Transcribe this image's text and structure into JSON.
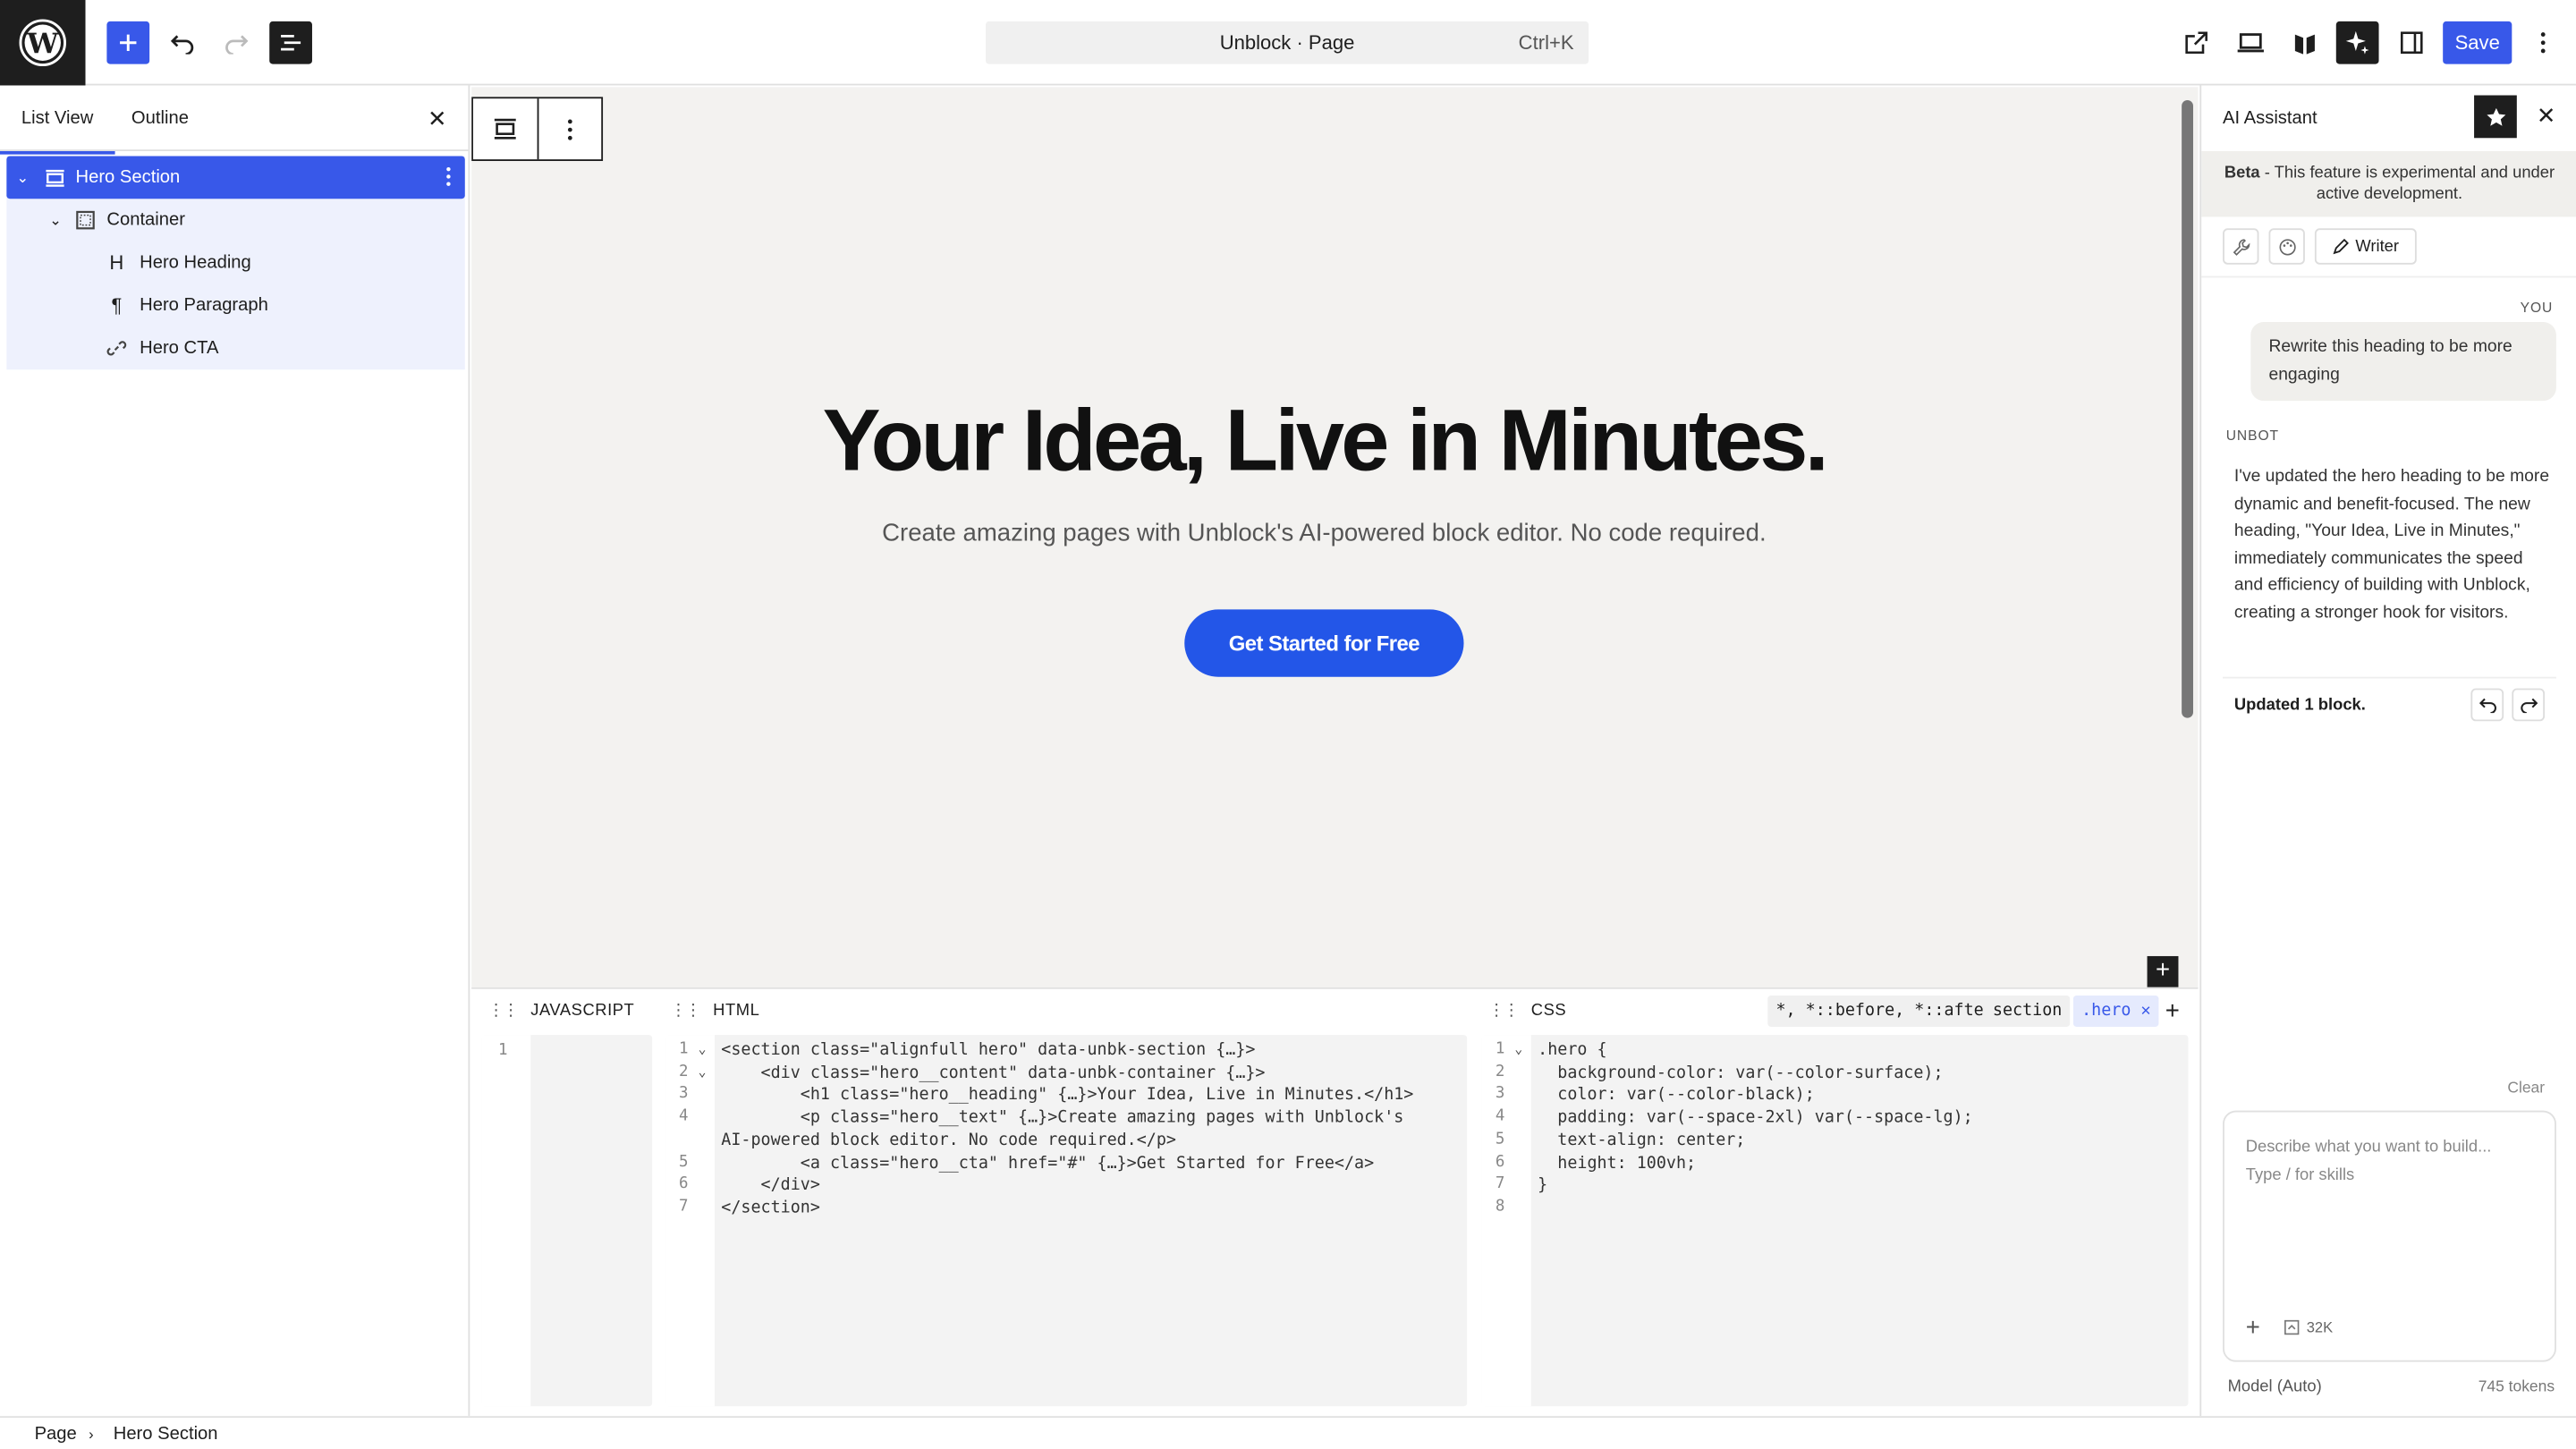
{
  "topbar": {
    "doc_title": "Unblock · Page",
    "shortcut": "Ctrl+K",
    "save_label": "Save"
  },
  "left_sidebar": {
    "tabs": [
      "List View",
      "Outline"
    ],
    "tree": [
      {
        "label": "Hero Section",
        "icon": "section-icon",
        "selected": true
      },
      {
        "label": "Container",
        "icon": "container-icon"
      },
      {
        "label": "Hero Heading",
        "icon": "heading-icon"
      },
      {
        "label": "Hero Paragraph",
        "icon": "paragraph-icon"
      },
      {
        "label": "Hero CTA",
        "icon": "link-icon"
      }
    ]
  },
  "canvas": {
    "heading": "Your Idea, Live in Minutes.",
    "paragraph": "Create amazing pages with Unblock's AI-powered block editor. No code required.",
    "cta": "Get Started for Free"
  },
  "code_panels": {
    "js_title": "JAVASCRIPT",
    "html_title": "HTML",
    "css_title": "CSS",
    "css_selectors": [
      "*, *::before, *::after",
      "section",
      ".hero"
    ],
    "html_lines": [
      "<section class=\"alignfull hero\" data-unbk-section {…}>",
      "    <div class=\"hero__content\" data-unbk-container {…}>",
      "        <h1 class=\"hero__heading\" {…}>Your Idea, Live in Minutes.</h1>",
      "        <p class=\"hero__text\" {…}>Create amazing pages with Unblock's",
      "AI-powered block editor. No code required.</p>",
      "        <a class=\"hero__cta\" href=\"#\" {…}>Get Started for Free</a>",
      "    </div>",
      "</section>"
    ],
    "css_lines": [
      ".hero {",
      "  background-color: var(--color-surface);",
      "  color: var(--color-black);",
      "  padding: var(--space-2xl) var(--space-lg);",
      "  text-align: center;",
      "  height: 100vh;",
      "}",
      ""
    ]
  },
  "assistant": {
    "title": "AI Assistant",
    "beta_strong": "Beta",
    "beta_text": " - This feature is experimental and under active development.",
    "writer_label": "Writer",
    "you_label": "YOU",
    "you_message": "Rewrite this heading to be more engaging",
    "bot_label": "UNBOT",
    "bot_message": "I've updated the hero heading to be more dynamic and benefit-focused. The new heading, \"Your Idea, Live in Minutes,\" immediately communicates the speed and efficiency of building with Unblock, creating a stronger hook for visitors.",
    "updated_text": "Updated 1 block.",
    "clear_label": "Clear",
    "placeholder_line1": "Describe what you want to build...",
    "placeholder_line2": "Type / for skills",
    "context_size": "32K",
    "model_label": "Model (Auto)",
    "tokens_label": "745 tokens"
  },
  "breadcrumb": [
    "Page",
    "Hero Section"
  ]
}
